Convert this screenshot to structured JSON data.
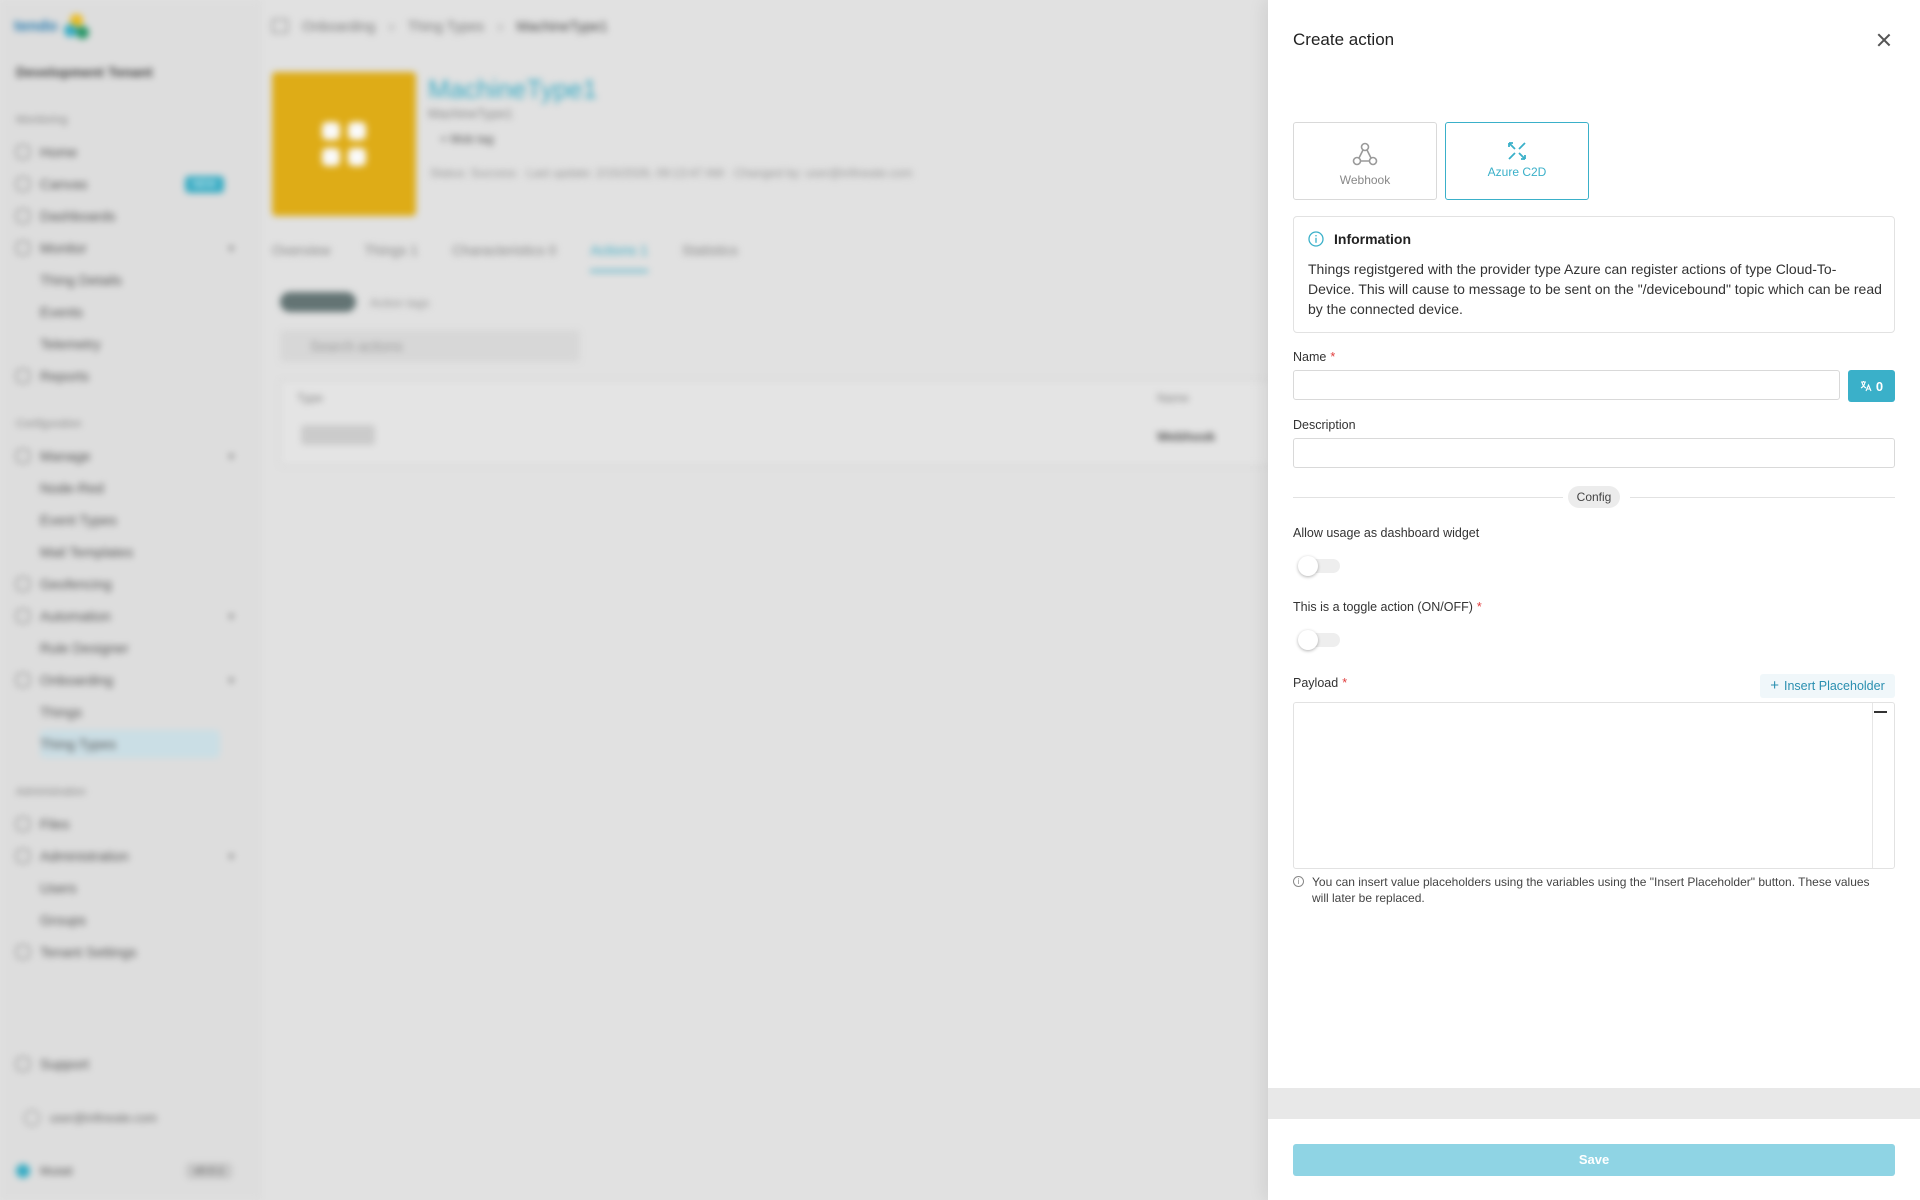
{
  "background": {
    "logo_text": "tendo",
    "tenant": "Development Tenant",
    "sidebar": {
      "section_monitoring": "Monitoring",
      "section_configuration": "Configuration",
      "section_administration": "Administration",
      "items": [
        {
          "label": "Home"
        },
        {
          "label": "Canvas",
          "badge": "NEW"
        },
        {
          "label": "Dashboards"
        },
        {
          "label": "Monitor"
        },
        {
          "label": "Thing Details"
        },
        {
          "label": "Events"
        },
        {
          "label": "Telemetry"
        },
        {
          "label": "Reports"
        },
        {
          "label": "Manage"
        },
        {
          "label": "Node-Red"
        },
        {
          "label": "Event Types"
        },
        {
          "label": "Mail Templates"
        },
        {
          "label": "Geofencing"
        },
        {
          "label": "Automation"
        },
        {
          "label": "Rule Designer"
        },
        {
          "label": "Onboarding"
        },
        {
          "label": "Things"
        },
        {
          "label": "Thing Types"
        },
        {
          "label": "Files"
        },
        {
          "label": "Administration"
        },
        {
          "label": "Users"
        },
        {
          "label": "Groups"
        },
        {
          "label": "Tenant Settings"
        }
      ],
      "support": "Support",
      "user_email": "user@infineate.com",
      "footer_name": "Mutati",
      "version": "v0.0.1"
    },
    "breadcrumb": [
      "Onboarding",
      "Thing Types",
      "MachineType1"
    ],
    "thing": {
      "title": "MachineType1",
      "subtitle": "MachineType1",
      "tag": "+ Mob tag",
      "meta": "Status: Success   ·   Last update: 2/15/2026, 09:13:47 AM   ·   Changed by: user@infineate.com"
    },
    "tabs": [
      "Overview",
      "Things  1",
      "Characteristics  0",
      "Actions  1",
      "Statistics"
    ],
    "filter_label": "Action tags",
    "search_placeholder": "Search actions",
    "table": {
      "col_type": "Type",
      "col_name": "Name",
      "row_name": "Webhook"
    }
  },
  "drawer": {
    "title": "Create action",
    "type_options": [
      {
        "label": "Webhook",
        "icon": "webhook-icon",
        "selected": false
      },
      {
        "label": "Azure C2D",
        "icon": "azure-c2d-icon",
        "selected": true
      }
    ],
    "info": {
      "heading": "Information",
      "text": "Things registgered with the provider type Azure can register actions of type Cloud-To-Device. This will cause to message to be sent on the \"/devicebound\" topic which can be read by the connected device."
    },
    "name_label": "Name",
    "name_value": "",
    "translation_count": "0",
    "description_label": "Description",
    "description_value": "",
    "config_label": "Config",
    "widget_toggle_label": "Allow usage as dashboard widget",
    "toggle_action_label": "This is a toggle action (ON/OFF)",
    "payload_label": "Payload",
    "insert_placeholder_label": "Insert Placeholder",
    "payload_hint": "You can insert value placeholders using the variables using the \"Insert Placeholder\" button. These values will later be replaced.",
    "save_label": "Save",
    "required_mark": "*",
    "accent_color": "#3ab0c9"
  }
}
